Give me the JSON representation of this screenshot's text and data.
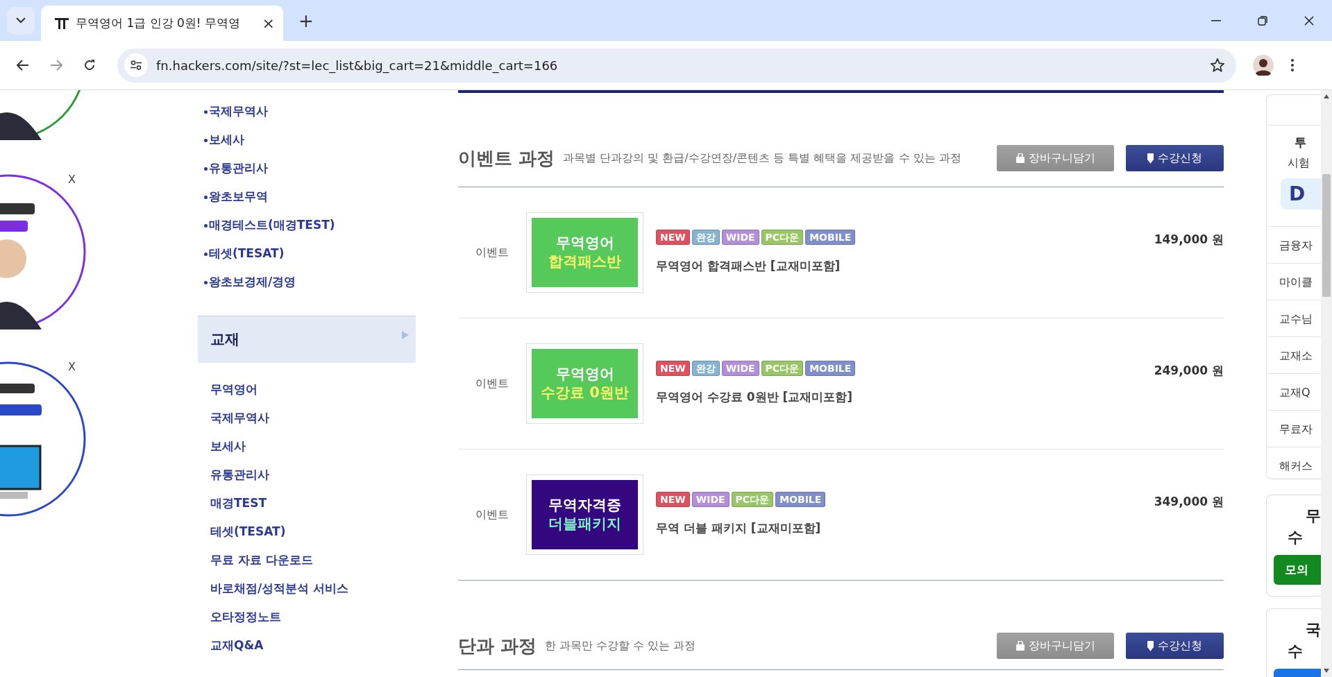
{
  "browser": {
    "tab_title": "무역영어 1급 인강 0원! 무역영",
    "tab_close": "×",
    "new_tab": "+",
    "url": "fn.hackers.com/site/?st=lec_list&big_cart=21&middle_cart=166"
  },
  "ads": [
    {
      "kind": "picture"
    },
    {
      "kind": "picture",
      "close": "X"
    },
    {
      "kind": "picture",
      "close": "X"
    }
  ],
  "sidebar": {
    "category_items": [
      "국제무역사",
      "보세사",
      "유통관리사",
      "왕초보무역",
      "매경테스트(매경TEST)",
      "테셋(TESAT)",
      "왕초보경제/경영"
    ],
    "section_title": "교재",
    "book_items": [
      "무역영어",
      "국제무역사",
      "보세사",
      "유통관리사",
      "매경TEST",
      "테셋(TESAT)",
      "무료 자료 다운로드",
      "바로채점/성적분석 서비스",
      "오타정정노트",
      "교재Q&A"
    ]
  },
  "event_section": {
    "title": "이벤트 과정",
    "description": "과목별 단과강의 및 환급/수강연장/콘텐츠 등 특별 혜택을 제공받을 수 있는 과정",
    "buttons": [
      {
        "kind": "cart",
        "label": "장바구니담기"
      },
      {
        "kind": "enroll",
        "label": "수강신청"
      }
    ],
    "courses": [
      {
        "category": "이벤트",
        "thumbnail": {
          "lines": [
            {
              "text": "무역영어",
              "color": "#ffffff"
            },
            {
              "text": "합격패스반",
              "color": "#f6f46a"
            }
          ],
          "color": "#55c95a"
        },
        "tags": [
          {
            "label": "NEW",
            "color": "#e0505f"
          },
          {
            "label": "완강",
            "color": "#86b3d1"
          },
          {
            "label": "WIDE",
            "color": "#b48ed8"
          },
          {
            "label": "PC다운",
            "color": "#99c768"
          },
          {
            "label": "MOBILE",
            "color": "#7f8fcb"
          }
        ],
        "name": "무역영어 합격패스반 [교재미포함]",
        "price": "149,000 원"
      },
      {
        "category": "이벤트",
        "thumbnail": {
          "lines": [
            {
              "text": "무역영어",
              "color": "#ffffff"
            },
            {
              "text": "수강료 0원반",
              "color": "#f6f46a"
            }
          ],
          "color": "#55c95a"
        },
        "tags": [
          {
            "label": "NEW",
            "color": "#e0505f"
          },
          {
            "label": "완강",
            "color": "#86b3d1"
          },
          {
            "label": "WIDE",
            "color": "#b48ed8"
          },
          {
            "label": "PC다운",
            "color": "#99c768"
          },
          {
            "label": "MOBILE",
            "color": "#7f8fcb"
          }
        ],
        "name": "무역영어 수강료 0원반 [교재미포함]",
        "price": "249,000 원"
      },
      {
        "category": "이벤트",
        "thumbnail": {
          "lines": [
            {
              "text": "무역자격증",
              "color": "#ffffff"
            },
            {
              "text": "더블패키지",
              "color": "#7ef0c8"
            }
          ],
          "color": "#34077e"
        },
        "tags": [
          {
            "label": "NEW",
            "color": "#e0505f"
          },
          {
            "label": "WIDE",
            "color": "#b48ed8"
          },
          {
            "label": "PC다운",
            "color": "#99c768"
          },
          {
            "label": "MOBILE",
            "color": "#7f8fcb"
          }
        ],
        "name": "무역 더블 패키지 [교재미포함]",
        "price": "349,000 원"
      }
    ]
  },
  "single_section": {
    "title": "단과 과정",
    "description": "한 과목만 수강할 수 있는 과정",
    "buttons": [
      {
        "kind": "cart",
        "label": "장바구니담기"
      },
      {
        "kind": "enroll",
        "label": "수강신청"
      }
    ]
  },
  "quick_menu": {
    "heading": "투",
    "subheading": "시험",
    "dday": "D",
    "links": [
      "금융자",
      "마이클",
      "교수님",
      "교재소",
      "교재Q",
      "무료자",
      "해커스"
    ]
  },
  "promo_cards": [
    {
      "lines": [
        "무",
        "수"
      ],
      "button": {
        "label": "모의",
        "color": "#138a1f"
      }
    },
    {
      "lines": [
        "국",
        "수"
      ],
      "button": {
        "color": "#1a73e8"
      }
    }
  ]
}
